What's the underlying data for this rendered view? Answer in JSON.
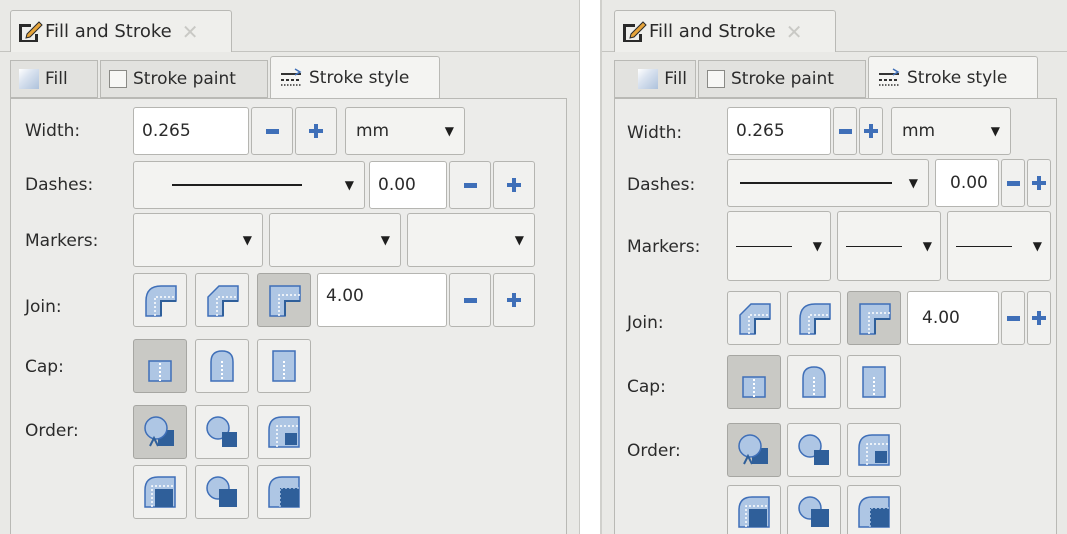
{
  "panels": [
    {
      "title": "Fill and Stroke",
      "tabs": {
        "fill": "Fill",
        "stroke_paint": "Stroke paint",
        "stroke_style": "Stroke style"
      },
      "labels": {
        "width": "Width:",
        "dashes": "Dashes:",
        "markers": "Markers:",
        "join": "Join:",
        "cap": "Cap:",
        "order": "Order:"
      },
      "width_value": "0.265",
      "unit": "mm",
      "dash_offset": "0.00",
      "miter_limit": "4.00"
    },
    {
      "title": "Fill and Stroke",
      "tabs": {
        "fill": "Fill",
        "stroke_paint": "Stroke paint",
        "stroke_style": "Stroke style"
      },
      "labels": {
        "width": "Width:",
        "dashes": "Dashes:",
        "markers": "Markers:",
        "join": "Join:",
        "cap": "Cap:",
        "order": "Order:"
      },
      "width_value": "0.265",
      "unit": "mm",
      "dash_offset": "0.00",
      "miter_limit": "4.00"
    }
  ],
  "colors": {
    "accent": "#3f6fb8",
    "icon_fill": "#aec6e4",
    "pressed": "#c9c9c5",
    "panel_bg": "#e9e9e6"
  },
  "icons": {
    "title": "pen-icon",
    "close": "close-icon",
    "plus": "plus-icon",
    "minus": "minus-icon"
  }
}
